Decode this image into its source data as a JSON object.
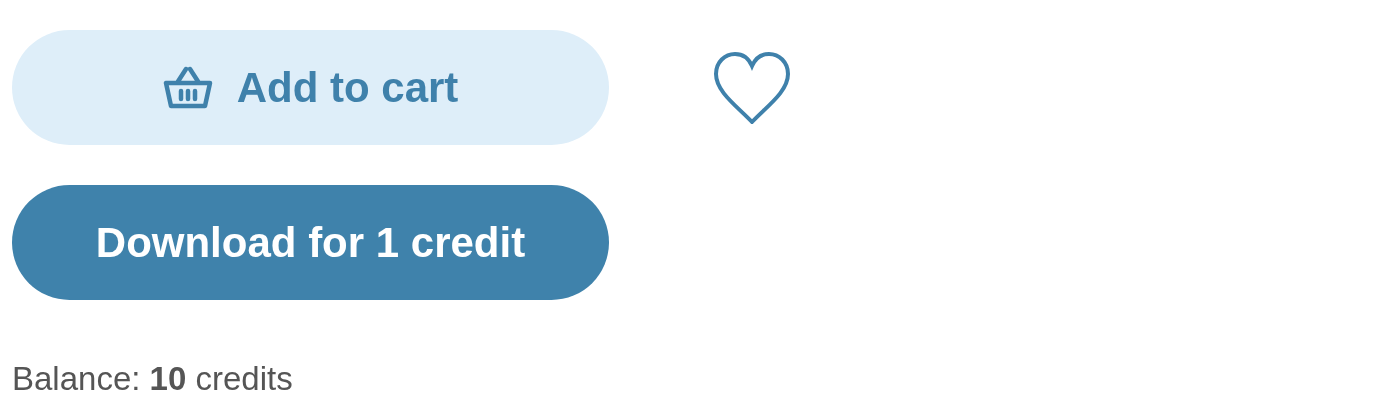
{
  "add_to_cart": {
    "label": "Add to cart"
  },
  "download": {
    "label": "Download for 1 credit"
  },
  "balance": "Balance: **10** credits"
}
